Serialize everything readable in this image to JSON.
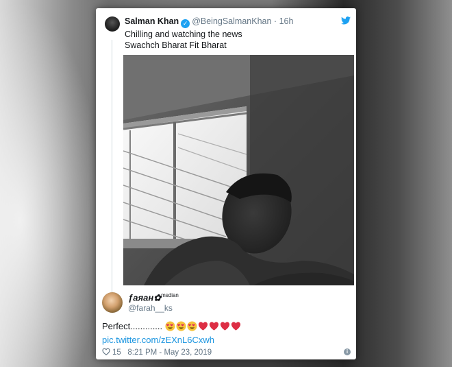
{
  "quoted_tweet": {
    "name": "Salman Khan",
    "handle": "@BeingSalmanKhan",
    "separator": "·",
    "time": "16h",
    "text_line1": "Chilling and watching the news",
    "text_line2": "Swachch Bharat Fit Bharat",
    "photo_icon": "selfie-photo",
    "verified_icon": "verified-badge-icon",
    "brand_icon": "twitter-bird-icon",
    "accent_color": "#1da1f2"
  },
  "reply": {
    "name": "ƒaяaн✿",
    "name_sup": "msdian",
    "handle": "@farah__ks",
    "text": "Perfect.............",
    "emojis": [
      "heart-eyes-icon",
      "heart-eyes-icon",
      "heart-eyes-icon",
      "red-heart-icon",
      "red-heart-icon",
      "red-heart-icon",
      "red-heart-icon"
    ],
    "link": "pic.twitter.com/zEXnL6Cxwh",
    "likes": "15",
    "timestamp": "8:21 PM - May 23, 2019",
    "link_color": "#1b95e0"
  }
}
